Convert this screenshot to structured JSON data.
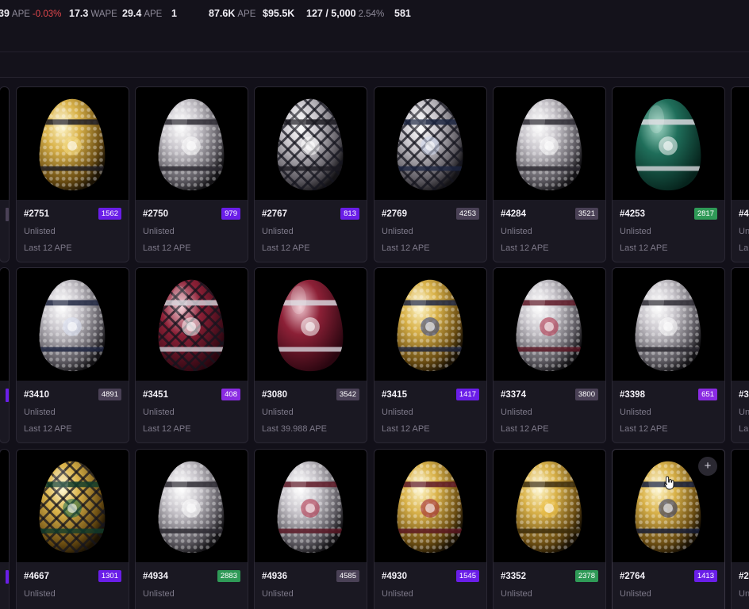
{
  "stats": [
    {
      "label": "",
      "value": "39",
      "unit": "APE",
      "change": "-0.03%"
    },
    {
      "label": "",
      "value": "17.3",
      "unit": "WAPE"
    },
    {
      "label": "",
      "value": "29.4",
      "unit": "APE"
    },
    {
      "label": "",
      "value": "1"
    },
    {
      "label": "",
      "value": "87.6K",
      "unit": "APE"
    },
    {
      "label": "",
      "value": "$95.5K"
    },
    {
      "label": "",
      "value": "127 / 5,000",
      "pct": "2.54%"
    },
    {
      "label": "",
      "value": "581"
    }
  ],
  "colors": {
    "rank_purple": "#6a1ee8",
    "rank_gray": "#4a4156",
    "rank_green": "#2f9a57",
    "rank_violet": "#8a2be2"
  },
  "cards": [
    {
      "id": "#2751",
      "rank": "1562",
      "rank_color": "purple",
      "status": "Unlisted",
      "last": "Last 12 APE",
      "egg": "gold"
    },
    {
      "id": "#2750",
      "rank": "979",
      "rank_color": "purple",
      "status": "Unlisted",
      "last": "Last 12 APE",
      "egg": "silver"
    },
    {
      "id": "#2767",
      "rank": "813",
      "rank_color": "purple",
      "status": "Unlisted",
      "last": "Last 12 APE",
      "egg": "lattice"
    },
    {
      "id": "#2769",
      "rank": "4253",
      "rank_color": "gray",
      "status": "Unlisted",
      "last": "Last 12 APE",
      "egg": "navy"
    },
    {
      "id": "#4284",
      "rank": "3521",
      "rank_color": "gray",
      "status": "Unlisted",
      "last": "Last 12 APE",
      "egg": "silver"
    },
    {
      "id": "#4253",
      "rank": "2817",
      "rank_color": "green",
      "status": "Unlisted",
      "last": "Last 12 APE",
      "egg": "emerald"
    },
    {
      "id": "#3410",
      "rank": "4891",
      "rank_color": "gray",
      "status": "Unlisted",
      "last": "Last 12 APE",
      "egg": "sapphire"
    },
    {
      "id": "#3451",
      "rank": "408",
      "rank_color": "violet",
      "status": "Unlisted",
      "last": "Last 12 APE",
      "egg": "ruby"
    },
    {
      "id": "#3080",
      "rank": "3542",
      "rank_color": "gray",
      "status": "Unlisted",
      "last": "Last 39.988 APE",
      "egg": "burgundy"
    },
    {
      "id": "#3415",
      "rank": "1417",
      "rank_color": "purple",
      "status": "Unlisted",
      "last": "Last 12 APE",
      "egg": "goldsapphire"
    },
    {
      "id": "#3374",
      "rank": "3800",
      "rank_color": "gray",
      "status": "Unlisted",
      "last": "Last 12 APE",
      "egg": "rubysilver"
    },
    {
      "id": "#3398",
      "rank": "651",
      "rank_color": "violet",
      "status": "Unlisted",
      "last": "Last 12 APE",
      "egg": "silver"
    },
    {
      "id": "#4667",
      "rank": "1301",
      "rank_color": "purple",
      "status": "Unlisted",
      "last": "",
      "egg": "goldemerald"
    },
    {
      "id": "#4934",
      "rank": "2883",
      "rank_color": "green",
      "status": "Unlisted",
      "last": "",
      "egg": "silver"
    },
    {
      "id": "#4936",
      "rank": "4585",
      "rank_color": "gray",
      "status": "Unlisted",
      "last": "",
      "egg": "rubysilver"
    },
    {
      "id": "#4930",
      "rank": "1545",
      "rank_color": "purple",
      "status": "Unlisted",
      "last": "",
      "egg": "goldruby"
    },
    {
      "id": "#3352",
      "rank": "2378",
      "rank_color": "green",
      "status": "Unlisted",
      "last": "",
      "egg": "bitcoin"
    },
    {
      "id": "#2764",
      "rank": "1413",
      "rank_color": "purple",
      "status": "Unlisted",
      "last": "",
      "egg": "goldnavy",
      "add_button": "+"
    }
  ],
  "right_edge": [
    {
      "id_partial": "#4",
      "status_partial": "Un",
      "last_partial": "La"
    },
    {
      "id_partial": "#3",
      "status_partial": "Un",
      "last_partial": "La"
    },
    {
      "id_partial": "#2",
      "status_partial": "Un",
      "last_partial": ""
    }
  ]
}
